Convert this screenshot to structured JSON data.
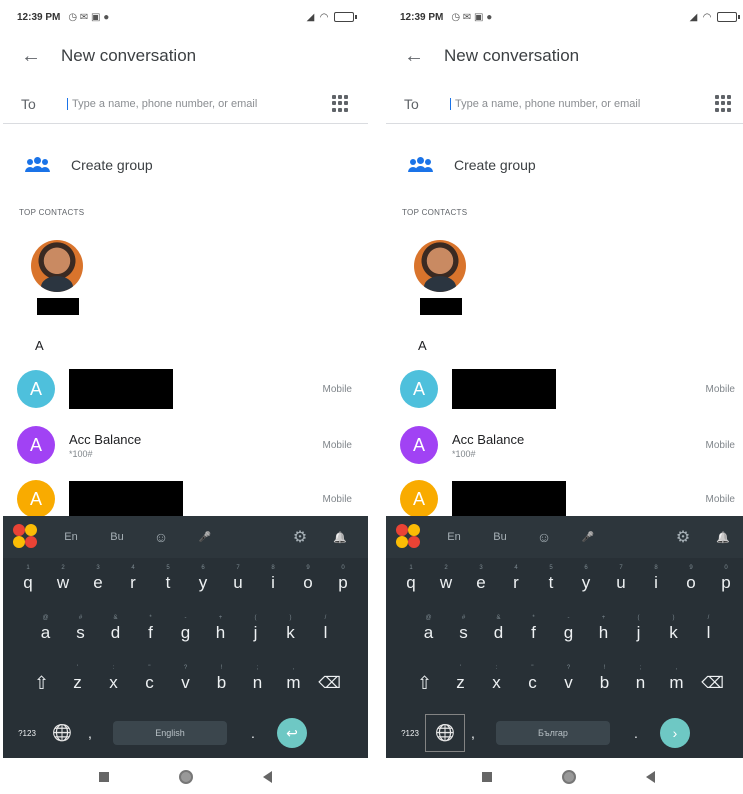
{
  "screens": [
    {
      "status": {
        "time": "12:39 PM",
        "left_icons": "◷ ✉ ▣ ●"
      },
      "appbar": {
        "title": "New conversation"
      },
      "to_row": {
        "label": "To",
        "placeholder": "Type a name, phone number, or email"
      },
      "create_group": {
        "label": "Create group"
      },
      "top_contacts": {
        "header": "TOP CONTACTS"
      },
      "section_letter": "A",
      "contacts": [
        {
          "initial": "A",
          "name": "",
          "sub": "",
          "type": "Mobile",
          "color": "#4ec0dc",
          "redacted": true
        },
        {
          "initial": "A",
          "name": "Acc Balance",
          "sub": "*100#",
          "type": "Mobile",
          "color": "#a142f4",
          "redacted": false
        },
        {
          "initial": "A",
          "name": "",
          "sub": "",
          "type": "Mobile",
          "color": "#f9ab00",
          "redacted": true
        }
      ],
      "keyboard": {
        "toolbar": {
          "lang": "En",
          "translit": "Bu",
          "emoji": "☺",
          "mic": "🎤",
          "settings": "⚙",
          "bell": "🔔"
        },
        "row1": [
          {
            "k": "q",
            "h": "1"
          },
          {
            "k": "w",
            "h": "2"
          },
          {
            "k": "e",
            "h": "3"
          },
          {
            "k": "r",
            "h": "4"
          },
          {
            "k": "t",
            "h": "5"
          },
          {
            "k": "y",
            "h": "6"
          },
          {
            "k": "u",
            "h": "7"
          },
          {
            "k": "i",
            "h": "8"
          },
          {
            "k": "o",
            "h": "9"
          },
          {
            "k": "p",
            "h": "0"
          }
        ],
        "row2": [
          {
            "k": "a",
            "h": "@"
          },
          {
            "k": "s",
            "h": "#"
          },
          {
            "k": "d",
            "h": "&"
          },
          {
            "k": "f",
            "h": "*"
          },
          {
            "k": "g",
            "h": "-"
          },
          {
            "k": "h",
            "h": "+"
          },
          {
            "k": "j",
            "h": "("
          },
          {
            "k": "k",
            "h": ")"
          },
          {
            "k": "l",
            "h": "/"
          }
        ],
        "row3": [
          {
            "k": "z",
            "h": "'"
          },
          {
            "k": "x",
            "h": ":"
          },
          {
            "k": "c",
            "h": "\""
          },
          {
            "k": "v",
            "h": "?"
          },
          {
            "k": "b",
            "h": "!"
          },
          {
            "k": "n",
            "h": ";"
          },
          {
            "k": "m",
            "h": ","
          }
        ],
        "shift": "⇧",
        "backspace": "⌫",
        "sym": "?123",
        "globe": "🌐",
        "comma": ",",
        "period": ".",
        "space": "English",
        "enter": "↩",
        "globe_highlighted": false
      }
    },
    {
      "status": {
        "time": "12:39 PM",
        "left_icons": "◷ ✉ ▣ ●"
      },
      "appbar": {
        "title": "New conversation"
      },
      "to_row": {
        "label": "To",
        "placeholder": "Type a name, phone number, or email"
      },
      "create_group": {
        "label": "Create group"
      },
      "top_contacts": {
        "header": "TOP CONTACTS"
      },
      "section_letter": "A",
      "contacts": [
        {
          "initial": "A",
          "name": "",
          "sub": "",
          "type": "Mobile",
          "color": "#4ec0dc",
          "redacted": true
        },
        {
          "initial": "A",
          "name": "Acc Balance",
          "sub": "*100#",
          "type": "Mobile",
          "color": "#a142f4",
          "redacted": false
        },
        {
          "initial": "A",
          "name": "",
          "sub": "",
          "type": "Mobile",
          "color": "#f9ab00",
          "redacted": true
        }
      ],
      "keyboard": {
        "toolbar": {
          "lang": "En",
          "translit": "Bu",
          "emoji": "☺",
          "mic": "🎤",
          "settings": "⚙",
          "bell": "🔔"
        },
        "row1": [
          {
            "k": "q",
            "h": "1"
          },
          {
            "k": "w",
            "h": "2"
          },
          {
            "k": "e",
            "h": "3"
          },
          {
            "k": "r",
            "h": "4"
          },
          {
            "k": "t",
            "h": "5"
          },
          {
            "k": "y",
            "h": "6"
          },
          {
            "k": "u",
            "h": "7"
          },
          {
            "k": "i",
            "h": "8"
          },
          {
            "k": "o",
            "h": "9"
          },
          {
            "k": "p",
            "h": "0"
          }
        ],
        "row2": [
          {
            "k": "a",
            "h": "@"
          },
          {
            "k": "s",
            "h": "#"
          },
          {
            "k": "d",
            "h": "&"
          },
          {
            "k": "f",
            "h": "*"
          },
          {
            "k": "g",
            "h": "-"
          },
          {
            "k": "h",
            "h": "+"
          },
          {
            "k": "j",
            "h": "("
          },
          {
            "k": "k",
            "h": ")"
          },
          {
            "k": "l",
            "h": "/"
          }
        ],
        "row3": [
          {
            "k": "z",
            "h": "'"
          },
          {
            "k": "x",
            "h": ":"
          },
          {
            "k": "c",
            "h": "\""
          },
          {
            "k": "v",
            "h": "?"
          },
          {
            "k": "b",
            "h": "!"
          },
          {
            "k": "n",
            "h": ";"
          },
          {
            "k": "m",
            "h": ","
          }
        ],
        "shift": "⇧",
        "backspace": "⌫",
        "sym": "?123",
        "globe": "🌐",
        "comma": ",",
        "period": ".",
        "space": "Българ",
        "enter": "›",
        "globe_highlighted": true
      }
    }
  ]
}
